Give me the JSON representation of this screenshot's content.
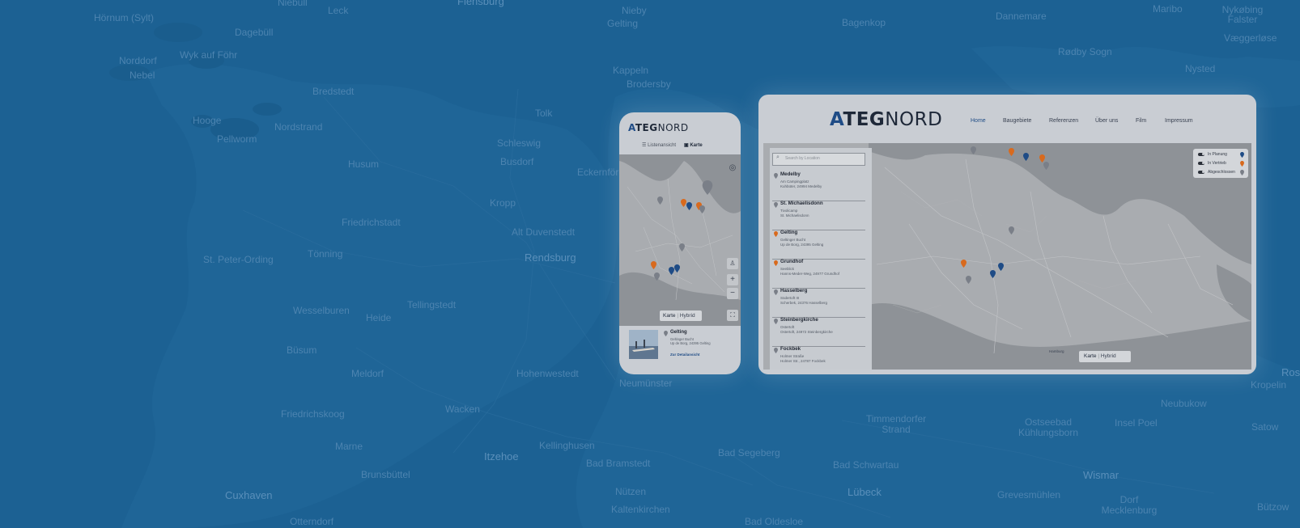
{
  "background_map": {
    "labels": [
      "Hörnum (Sylt)",
      "Niebüll",
      "Leck",
      "Flensburg",
      "Nieby",
      "Gelting",
      "Bagenkop",
      "Dannemare",
      "Maribo",
      "Nykøbing Falster",
      "Væggerløse",
      "Dagebüll",
      "Wyk auf Föhr",
      "Norddorf",
      "Nebel",
      "Kappeln",
      "Brodersby",
      "Rødby Sogn",
      "Nysted",
      "Bredstedt",
      "Tolk",
      "Hooge",
      "Pellworm",
      "Nordstrand",
      "Husum",
      "Schleswig",
      "Busdorf",
      "Eckernförde",
      "Friedrichstadt",
      "Kropp",
      "Alt Duvenstedt",
      "Tönning",
      "St. Peter-Ording",
      "Rendsburg",
      "Wesselburen",
      "Heide",
      "Tellingstedt",
      "Büsum",
      "Meldorf",
      "Hohenwestedt",
      "Neumünster",
      "Kropelin",
      "Friedrichskoog",
      "Wacken",
      "Timmendorfer Strand",
      "Ostseebad Kühlungsborn",
      "Insel Poel",
      "Neubukow",
      "Satow",
      "Marne",
      "Itzehoe",
      "Kellinghusen",
      "Bad Bramstedt",
      "Bad Segeberg",
      "Bad Schwartau",
      "Wismar",
      "Brunsbüttel",
      "Cuxhaven",
      "Otterndorf",
      "Nützen",
      "Kaltenkirchen",
      "Lübeck",
      "Grevesmühlen",
      "Dorf Mecklenburg",
      "Bad Oldesloe",
      "Bützow",
      "Ros"
    ]
  },
  "mobile": {
    "logo": {
      "a": "A",
      "teg": "TEG",
      "nord": "NORD"
    },
    "tabs": {
      "list": "Listenansicht",
      "map": "Karte"
    },
    "map_toggle": {
      "map": "Karte",
      "hybrid": "Hybrid"
    },
    "controls": {
      "zoom_in": "+",
      "zoom_out": "−"
    },
    "preview": {
      "name": "Gelting",
      "l1": "Geltinger Bucht",
      "l2": "Up de Borg, 24395 Gelting",
      "link": "Zur Detailansicht"
    }
  },
  "desktop": {
    "logo": {
      "a": "A",
      "teg": "TEG",
      "nord": "NORD"
    },
    "nav": [
      "Home",
      "Baugebiete",
      "Referenzen",
      "Über uns",
      "Film",
      "Impressum"
    ],
    "search": {
      "placeholder": "Search by Location"
    },
    "locations": [
      {
        "name": "Medelby",
        "l1": "Am Campingplatz",
        "l2": "Kuhbüter, 24994 Medelby",
        "status": "done"
      },
      {
        "name": "St. Michaelisdonn",
        "l1": "Tivolicamp",
        "l2": "St. Michaelisdonn",
        "status": "done"
      },
      {
        "name": "Gelting",
        "l1": "Geltinger Bucht",
        "l2": "Up de Borg, 24395 Gelting",
        "status": "sale"
      },
      {
        "name": "Grundhof",
        "l1": "Seeblick",
        "l2": "Hanns-Meder-Weg, 24977 Grundhof",
        "status": "sale"
      },
      {
        "name": "Hasselberg",
        "l1": "Südertoft III",
        "l2": "Scherbek, 24376 Hasselberg",
        "status": "done"
      },
      {
        "name": "Steinbergkirche",
        "l1": "Ostertoft",
        "l2": "Ostertoft, 24972 Steinbergkirche",
        "status": "done"
      },
      {
        "name": "Fockbek",
        "l1": "Holmer Straße",
        "l2": "Holmer Str., 24787 Fockbek",
        "status": "done"
      }
    ],
    "legend": [
      {
        "label": "In Planung",
        "color": "#1f4c86"
      },
      {
        "label": "In Vertrieb",
        "color": "#d86a1e"
      },
      {
        "label": "Abgeschlossen",
        "color": "#7a7f88"
      }
    ],
    "map_toggle": {
      "map": "Karte",
      "hybrid": "Hybrid"
    },
    "map_city": "Hamburg"
  },
  "colors": {
    "background": "#1c6193",
    "pin_planning": "#1f4c86",
    "pin_sale": "#d86a1e",
    "pin_done": "#7a7f88"
  }
}
